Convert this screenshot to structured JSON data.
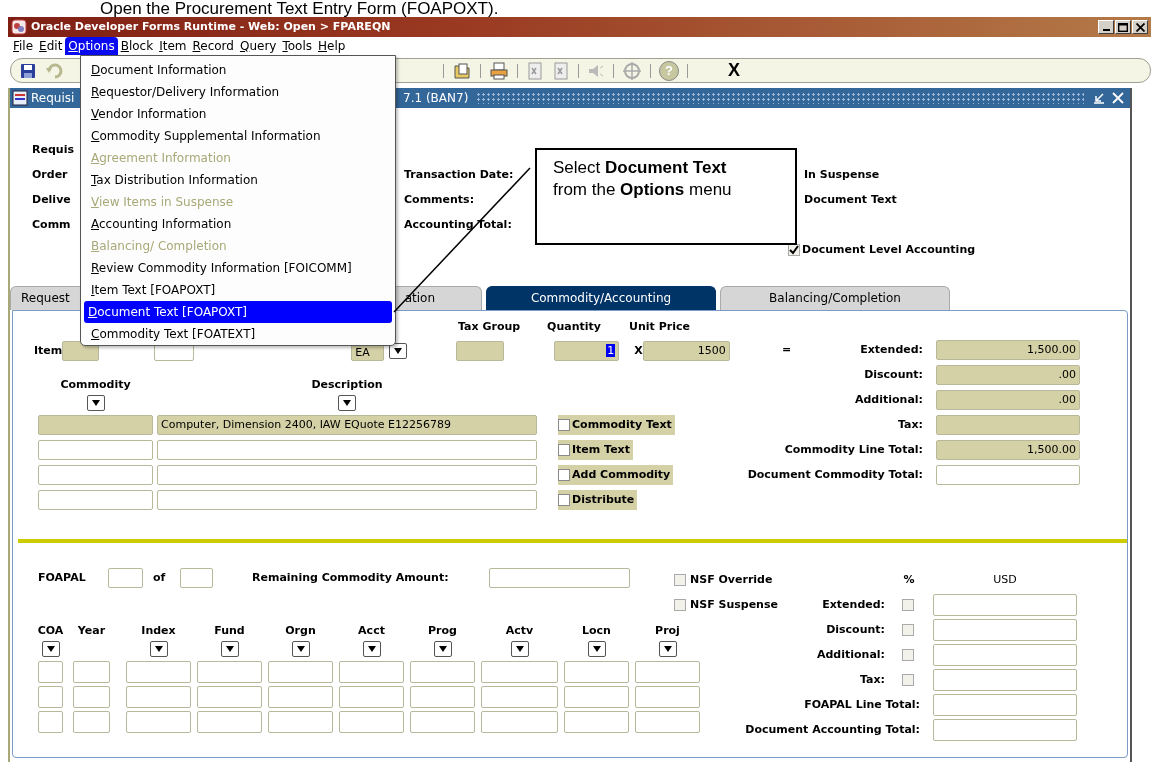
{
  "caption": "Open the Procurement Text Entry Form (FOAPOXT).",
  "window": {
    "title": "Oracle Developer Forms Runtime - Web:  Open > FPAREQN"
  },
  "menu_bar": [
    {
      "label": "File",
      "selected": false
    },
    {
      "label": "Edit",
      "selected": false
    },
    {
      "label": "Options",
      "selected": true
    },
    {
      "label": "Block",
      "selected": false
    },
    {
      "label": "Item",
      "selected": false
    },
    {
      "label": "Record",
      "selected": false
    },
    {
      "label": "Query",
      "selected": false
    },
    {
      "label": "Tools",
      "selected": false
    },
    {
      "label": "Help",
      "selected": false
    }
  ],
  "toolbar": {
    "help_glyph": "?",
    "exit_label": "X"
  },
  "form_window": {
    "title_start": "Requisi",
    "title_end": "7.1  (BAN7)"
  },
  "header": {
    "left_labels": [
      "Requis",
      "Order",
      "Delive",
      "Comm"
    ],
    "middle_labels": [
      "Transaction Date:",
      "Comments:",
      "Accounting Total:"
    ],
    "right_labels": [
      "In Suspense",
      "Document Text"
    ],
    "document_level_accounting": {
      "label": "Document Level Accounting",
      "checked": true
    }
  },
  "tabs": [
    {
      "label": "Request",
      "selected": false
    },
    {
      "label": "ation",
      "selected": false
    },
    {
      "label": "Commodity/Accounting",
      "selected": true
    },
    {
      "label": "Balancing/Completion",
      "selected": false
    }
  ],
  "commodity": {
    "item_label": "Item",
    "uom": "EA",
    "column_headers": [
      "Tax Group",
      "Quantity",
      "Unit Price"
    ],
    "quantity": "1",
    "quantity_selected": true,
    "times": "X",
    "unit_price": "1500",
    "equals": "=",
    "commodity_header": "Commodity",
    "description_header": "Description",
    "lines": [
      {
        "description": "Computer, Dimension 2400, IAW EQuote E12256789"
      }
    ],
    "options": [
      {
        "label": "Commodity Text",
        "checked": false
      },
      {
        "label": "Item Text",
        "checked": false
      },
      {
        "label": "Add Commodity",
        "checked": false
      },
      {
        "label": "Distribute",
        "checked": false
      }
    ],
    "totals": [
      {
        "label": "Extended:",
        "value": "1,500.00",
        "editable": false
      },
      {
        "label": "Discount:",
        "value": ".00",
        "editable": false
      },
      {
        "label": "Additional:",
        "value": ".00",
        "editable": false
      },
      {
        "label": "Tax:",
        "editable": false
      },
      {
        "label": "Commodity Line Total:",
        "value": "1,500.00",
        "editable": false
      },
      {
        "label": "Document Commodity Total:",
        "editable": true
      }
    ]
  },
  "accounting": {
    "foapal_label": "FOAPAL",
    "of_label": "of",
    "remaining_label": "Remaining Commodity Amount:",
    "nsf": [
      {
        "label": "NSF Override",
        "checked": false
      },
      {
        "label": "NSF Suspense",
        "checked": false
      }
    ],
    "percent_header": "%",
    "currency_header": "USD",
    "totals": [
      {
        "label": "Extended:",
        "kind": "percent",
        "checked": false
      },
      {
        "label": "Discount:",
        "kind": "percent",
        "checked": false
      },
      {
        "label": "Additional:",
        "kind": "percent",
        "checked": false
      },
      {
        "label": "Tax:",
        "kind": "percent",
        "checked": false
      },
      {
        "label": "FOAPAL Line Total:",
        "kind": "total"
      },
      {
        "label": "Document  Accounting  Total:",
        "kind": "total"
      }
    ],
    "columns": [
      {
        "label": "COA",
        "lov": true
      },
      {
        "label": "Year",
        "lov": false
      },
      {
        "label": "Index",
        "lov": true
      },
      {
        "label": "Fund",
        "lov": true
      },
      {
        "label": "Orgn",
        "lov": true
      },
      {
        "label": "Acct",
        "lov": true
      },
      {
        "label": "Prog",
        "lov": true
      },
      {
        "label": "Actv",
        "lov": true
      },
      {
        "label": "Locn",
        "lov": true
      },
      {
        "label": "Proj",
        "lov": true
      }
    ]
  },
  "options_menu": [
    {
      "label": "Document Information",
      "disabled": false,
      "selected": false
    },
    {
      "label": "Requestor/Delivery Information",
      "disabled": false,
      "selected": false
    },
    {
      "label": "Vendor Information",
      "disabled": false,
      "selected": false
    },
    {
      "label": "Commodity Supplemental Information",
      "disabled": false,
      "selected": false
    },
    {
      "label": "Agreement Information",
      "disabled": true,
      "selected": false
    },
    {
      "label": "Tax Distribution Information",
      "disabled": false,
      "selected": false
    },
    {
      "label": "View Items in Suspense",
      "disabled": true,
      "selected": false
    },
    {
      "label": "Accounting Information",
      "disabled": false,
      "selected": false
    },
    {
      "label": "Balancing/ Completion",
      "disabled": true,
      "selected": false
    },
    {
      "label": "Review Commodity Information [FOICOMM]",
      "disabled": false,
      "selected": false
    },
    {
      "label": "Item Text [FOAPOXT]",
      "disabled": false,
      "selected": false
    },
    {
      "label": "Document Text [FOAPOXT]",
      "disabled": false,
      "selected": true
    },
    {
      "label": "Commodity Text [FOATEXT]",
      "disabled": false,
      "selected": false
    }
  ],
  "callout": "Select **Document Text**\nfrom the **Options** menu"
}
